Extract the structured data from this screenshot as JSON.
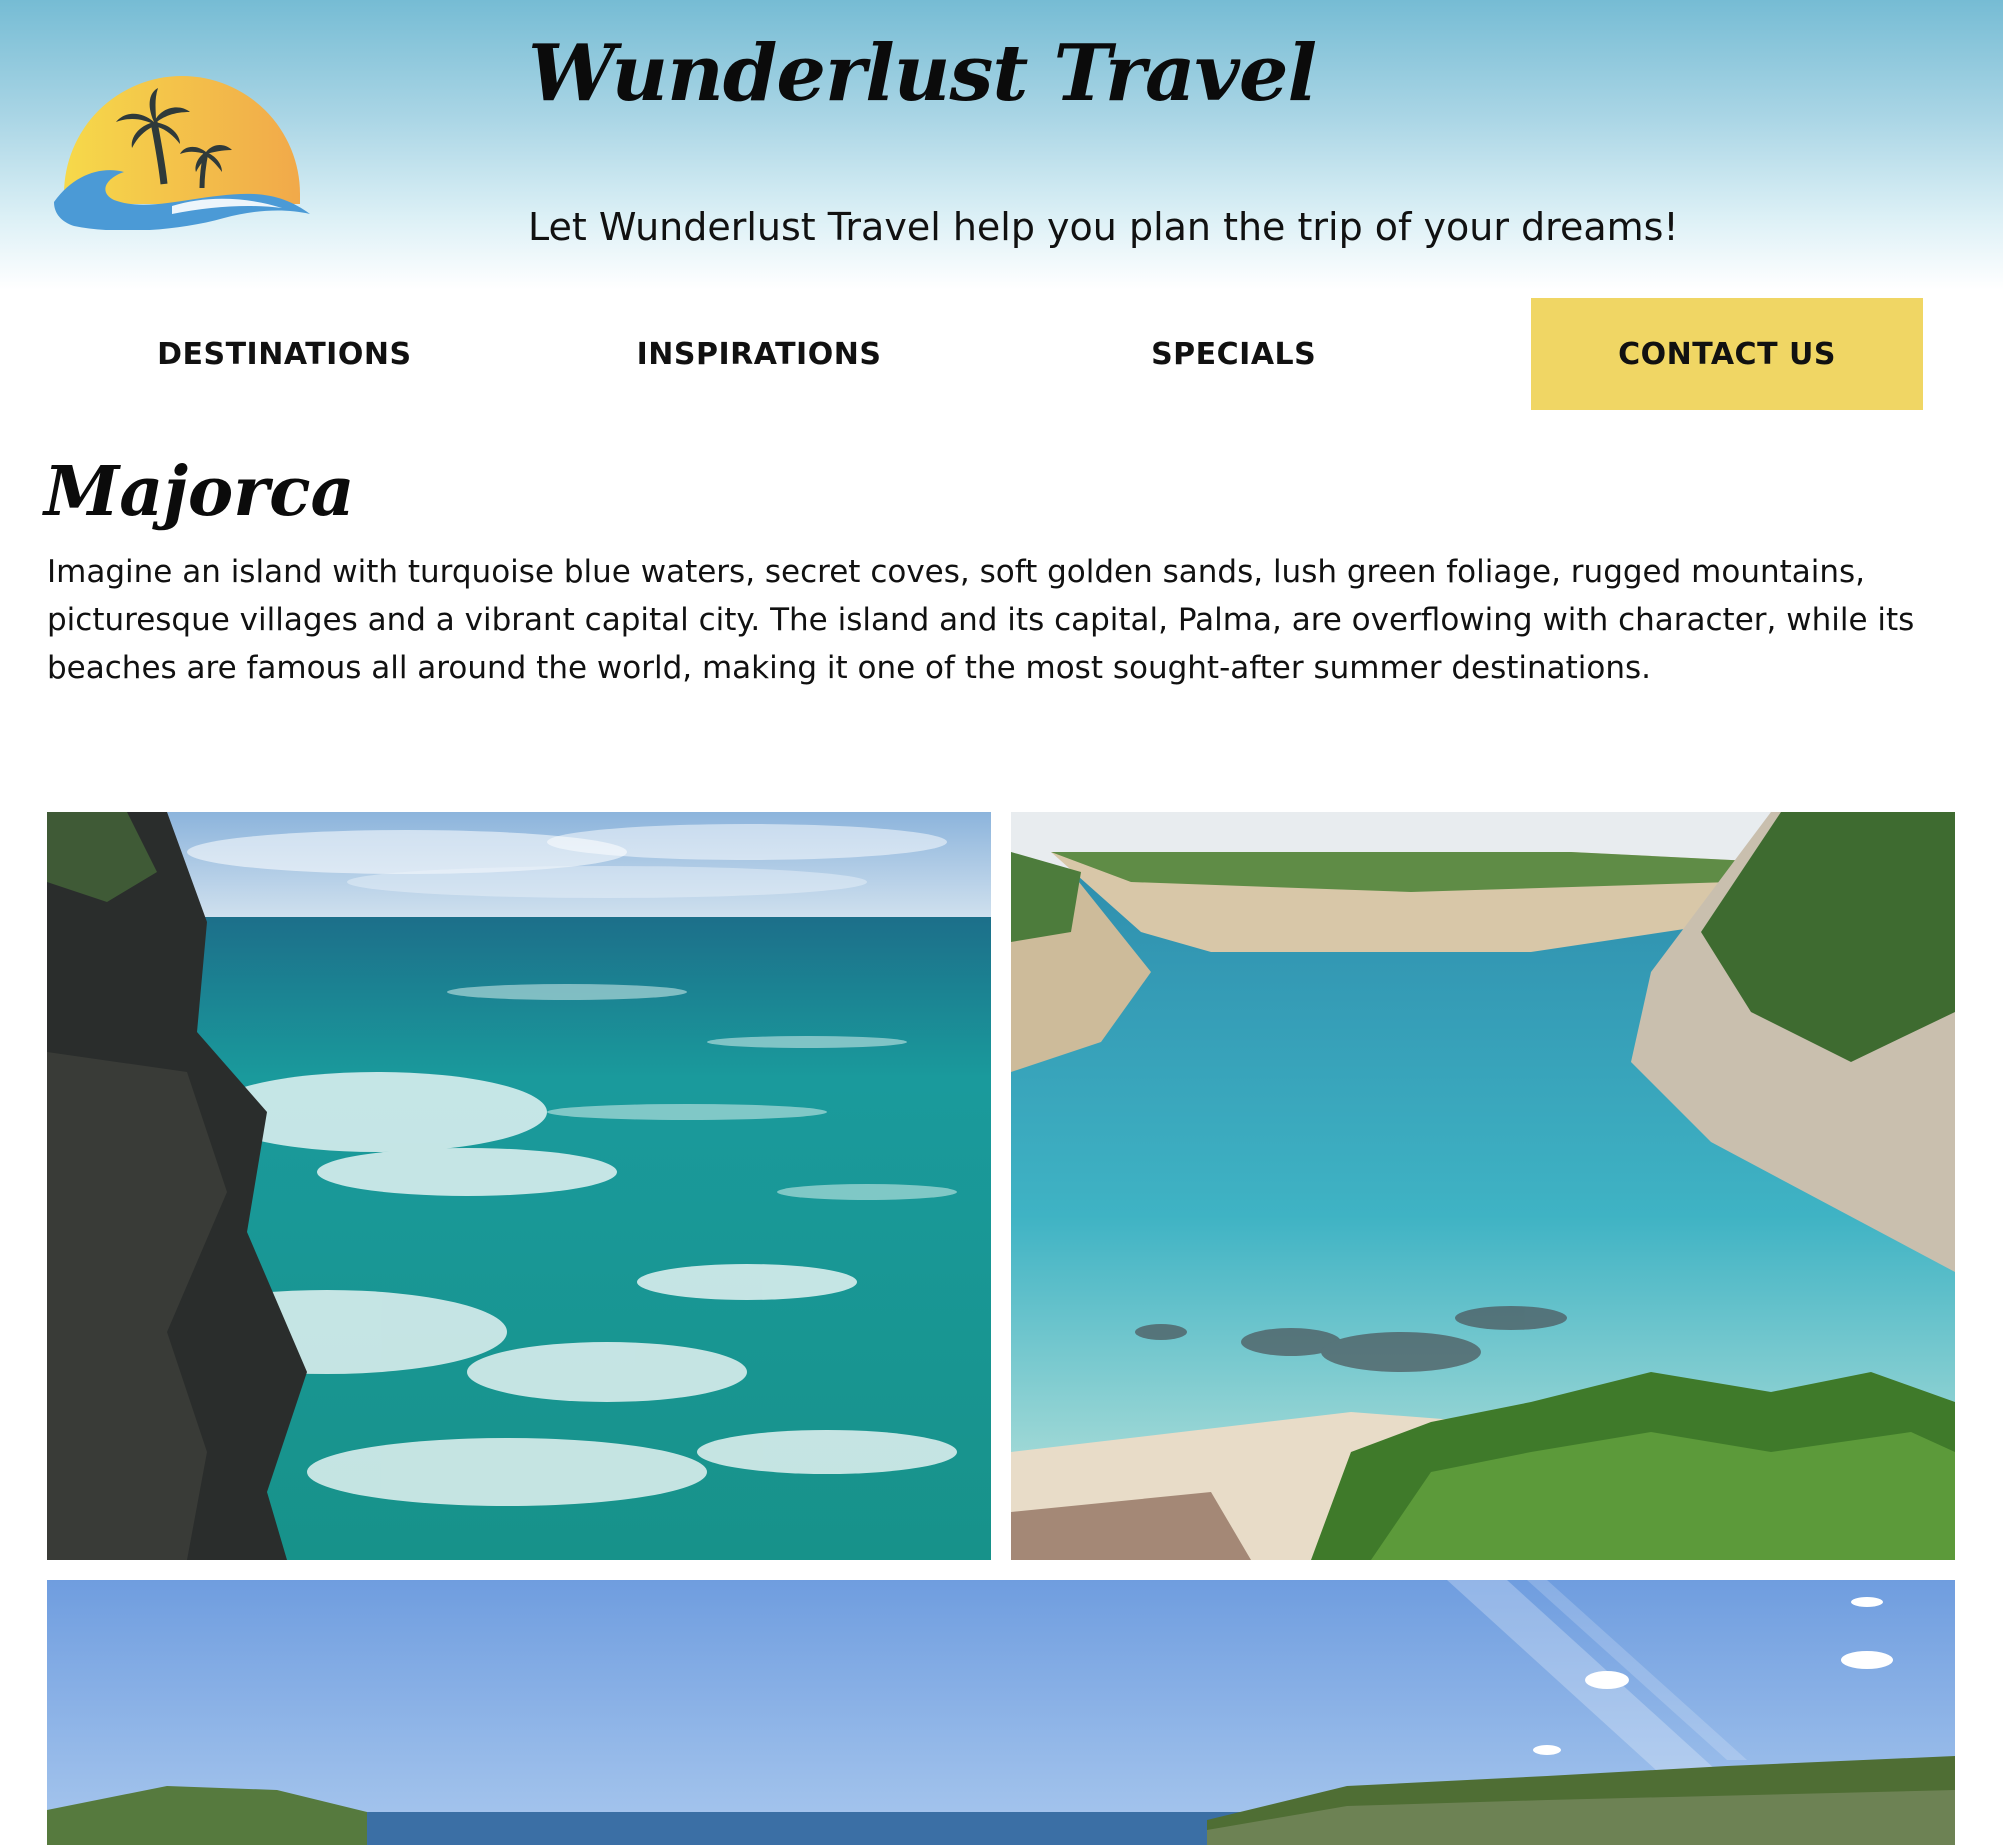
{
  "header": {
    "site_title": "Wunderlust Travel",
    "tagline": "Let Wunderlust Travel help you plan the trip of your dreams!",
    "logo_icon": "sunset-palm-tree-logo-icon"
  },
  "nav": {
    "items": [
      {
        "label": "DESTINATIONS"
      },
      {
        "label": "INSPIRATIONS"
      },
      {
        "label": "SPECIALS"
      },
      {
        "label": "CONTACT US"
      }
    ],
    "active_color": "#f0d664"
  },
  "main": {
    "title": "Majorca",
    "intro": "Imagine an island with turquoise blue waters, secret coves, soft golden sands, lush green foliage, rugged mountains, picturesque villages and a vibrant capital city. The island and its capital, Palma, are overflowing with character, while its beaches are famous all around the world, making it one of the most sought-after summer destinations."
  },
  "colors": {
    "header_top": "#76bcd4",
    "accent_yellow": "#f0d664",
    "sea_turquoise": "#1fa39c"
  }
}
